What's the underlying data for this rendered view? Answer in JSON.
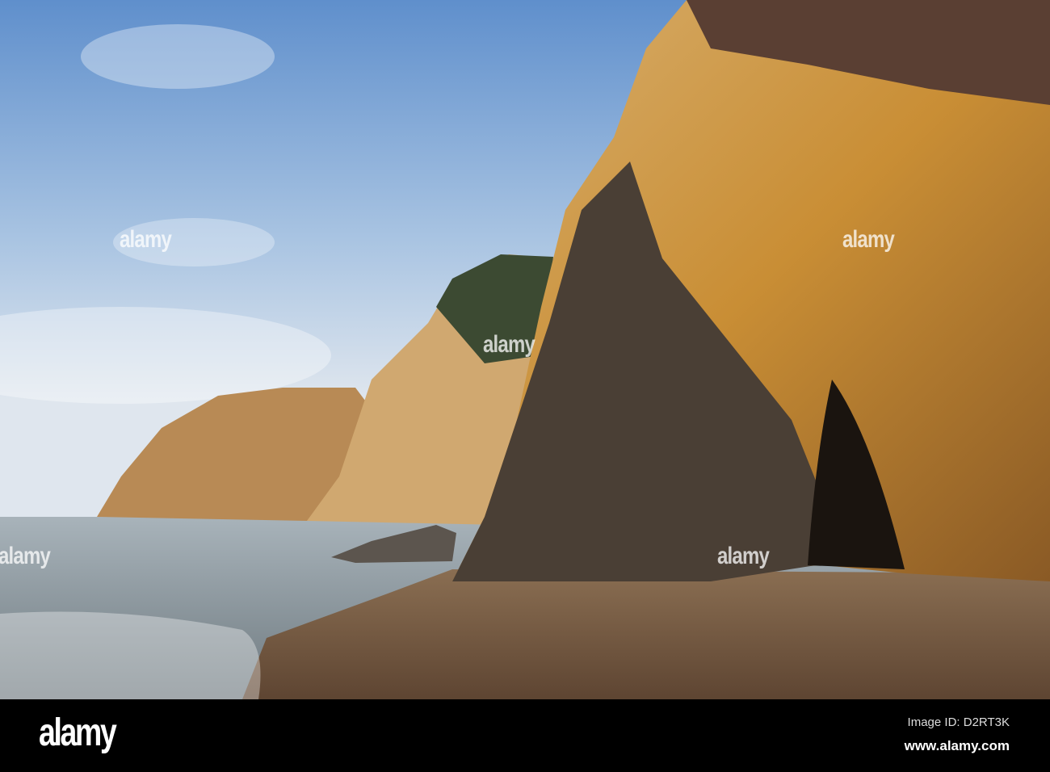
{
  "photo": {
    "subject": "Sea cliffs and cave on a sandy beach",
    "watermark": "alamy",
    "colors": {
      "sky": "#7ea7d6",
      "cliff": "#c8933c",
      "rock_dark": "#3c3530",
      "sand": "#7a5f44",
      "sea": "#8c9aa4"
    }
  },
  "footer": {
    "logo": "alamy",
    "image_id": "Image ID: D2RT3K",
    "url": "www.alamy.com"
  }
}
